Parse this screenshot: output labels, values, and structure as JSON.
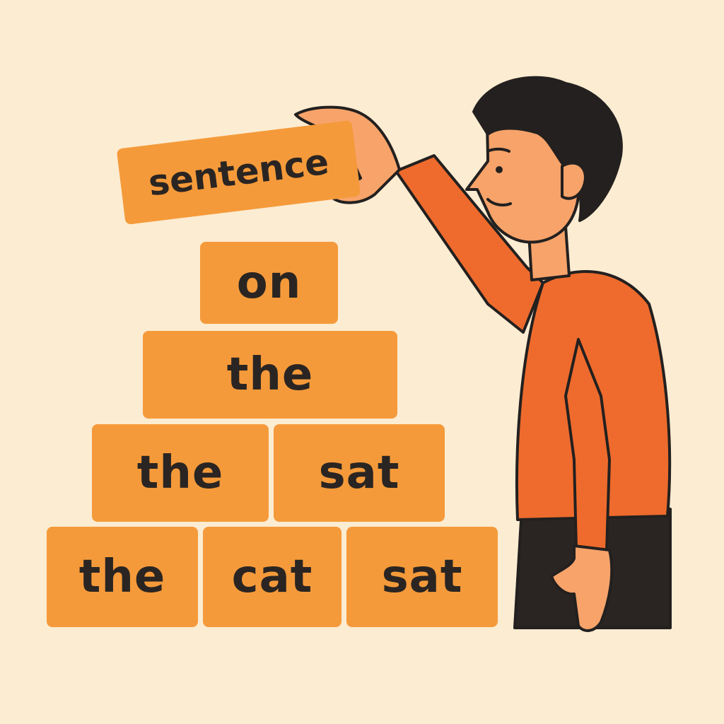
{
  "held_block": {
    "word": "sentence"
  },
  "pyramid": {
    "row1": [
      "on"
    ],
    "row2": [
      "the"
    ],
    "row3": [
      "the",
      "sat"
    ],
    "row4": [
      "the",
      "cat",
      "sat"
    ]
  },
  "colors": {
    "background": "#fcecd2",
    "block": "#f59a3a",
    "text": "#2a2522",
    "shirt": "#ee6b2d",
    "skin": "#f7a36a",
    "hair": "#23201f"
  }
}
